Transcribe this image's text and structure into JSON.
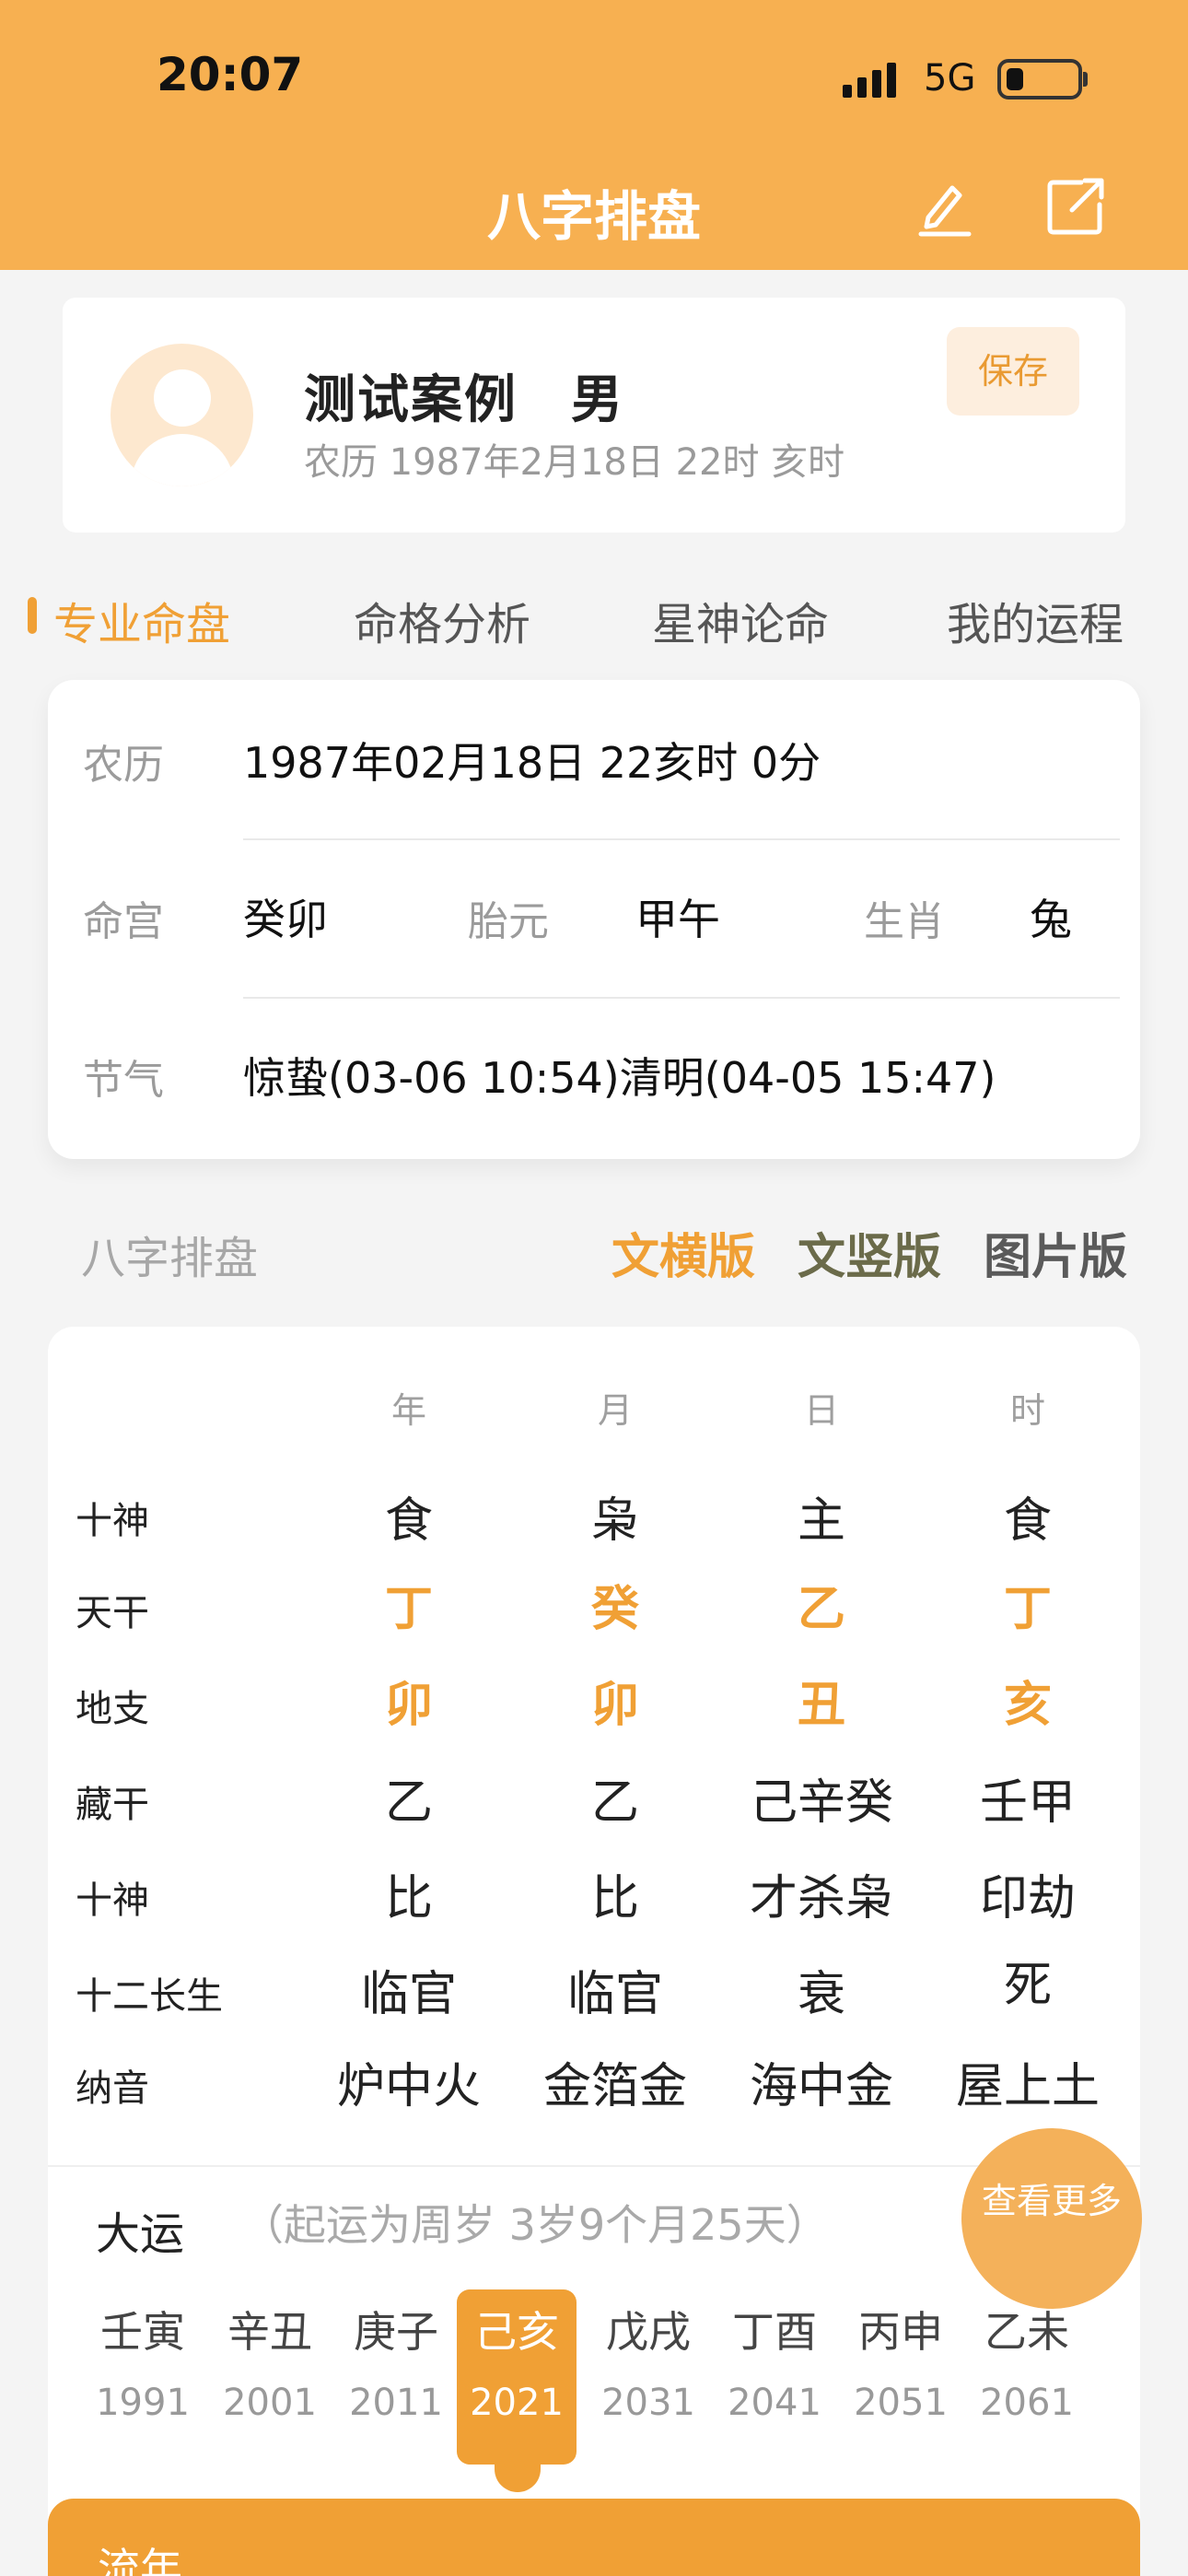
{
  "status": {
    "time": "20:07",
    "network": "5G"
  },
  "nav": {
    "title": "八字排盘"
  },
  "profile": {
    "name": "测试案例　男",
    "lunar_date": "农历 1987年2月18日 22时 亥时",
    "save_label": "保存"
  },
  "tabs": [
    "专业命盘",
    "命格分析",
    "星神论命",
    "我的运程"
  ],
  "info": {
    "lunar_label": "农历",
    "lunar_value": "1987年02月18日 22亥时 0分",
    "minggong_label": "命宫",
    "minggong_value": "癸卯",
    "taiyuan_label": "胎元",
    "taiyuan_value": "甲午",
    "shengxiao_label": "生肖",
    "shengxiao_value": "兔",
    "jieqi_label": "节气",
    "jieqi_value": "惊蛰(03-06 10:54)清明(04-05 15:47)"
  },
  "section": {
    "title": "八字排盘",
    "versions": [
      "文横版",
      "文竖版",
      "图片版"
    ]
  },
  "bazi": {
    "columns": [
      "年",
      "月",
      "日",
      "时"
    ],
    "rows": [
      {
        "label": "十神",
        "values": [
          "食",
          "枭",
          "主",
          "食"
        ],
        "highlight": false
      },
      {
        "label": "天干",
        "values": [
          "丁",
          "癸",
          "乙",
          "丁"
        ],
        "highlight": true
      },
      {
        "label": "地支",
        "values": [
          "卯",
          "卯",
          "丑",
          "亥"
        ],
        "highlight": true
      },
      {
        "label": "藏干",
        "values": [
          "乙",
          "乙",
          "己辛癸",
          "壬甲"
        ],
        "highlight": false
      },
      {
        "label": "十神",
        "values": [
          "比",
          "比",
          "才杀枭",
          "印劫"
        ],
        "highlight": false
      },
      {
        "label": "十二长生",
        "values": [
          "临官",
          "临官",
          "衰",
          "死"
        ],
        "highlight": false
      },
      {
        "label": "纳音",
        "values": [
          "炉中火",
          "金箔金",
          "海中金",
          "屋上土"
        ],
        "highlight": false
      }
    ]
  },
  "dayun": {
    "title": "大运",
    "note": "（起运为周岁 3岁9个月25天）",
    "more_label": "查看更多",
    "items": [
      {
        "ganzhi": "壬寅",
        "year": "1991"
      },
      {
        "ganzhi": "辛丑",
        "year": "2001"
      },
      {
        "ganzhi": "庚子",
        "year": "2011"
      },
      {
        "ganzhi": "己亥",
        "year": "2021"
      },
      {
        "ganzhi": "戊戌",
        "year": "2031"
      },
      {
        "ganzhi": "丁酉",
        "year": "2041"
      },
      {
        "ganzhi": "丙申",
        "year": "2051"
      },
      {
        "ganzhi": "乙未",
        "year": "2061"
      }
    ],
    "active_index": 3
  },
  "liunian": {
    "title": "流年"
  },
  "colors": {
    "accent": "#f0a035",
    "header": "#f7b051"
  }
}
